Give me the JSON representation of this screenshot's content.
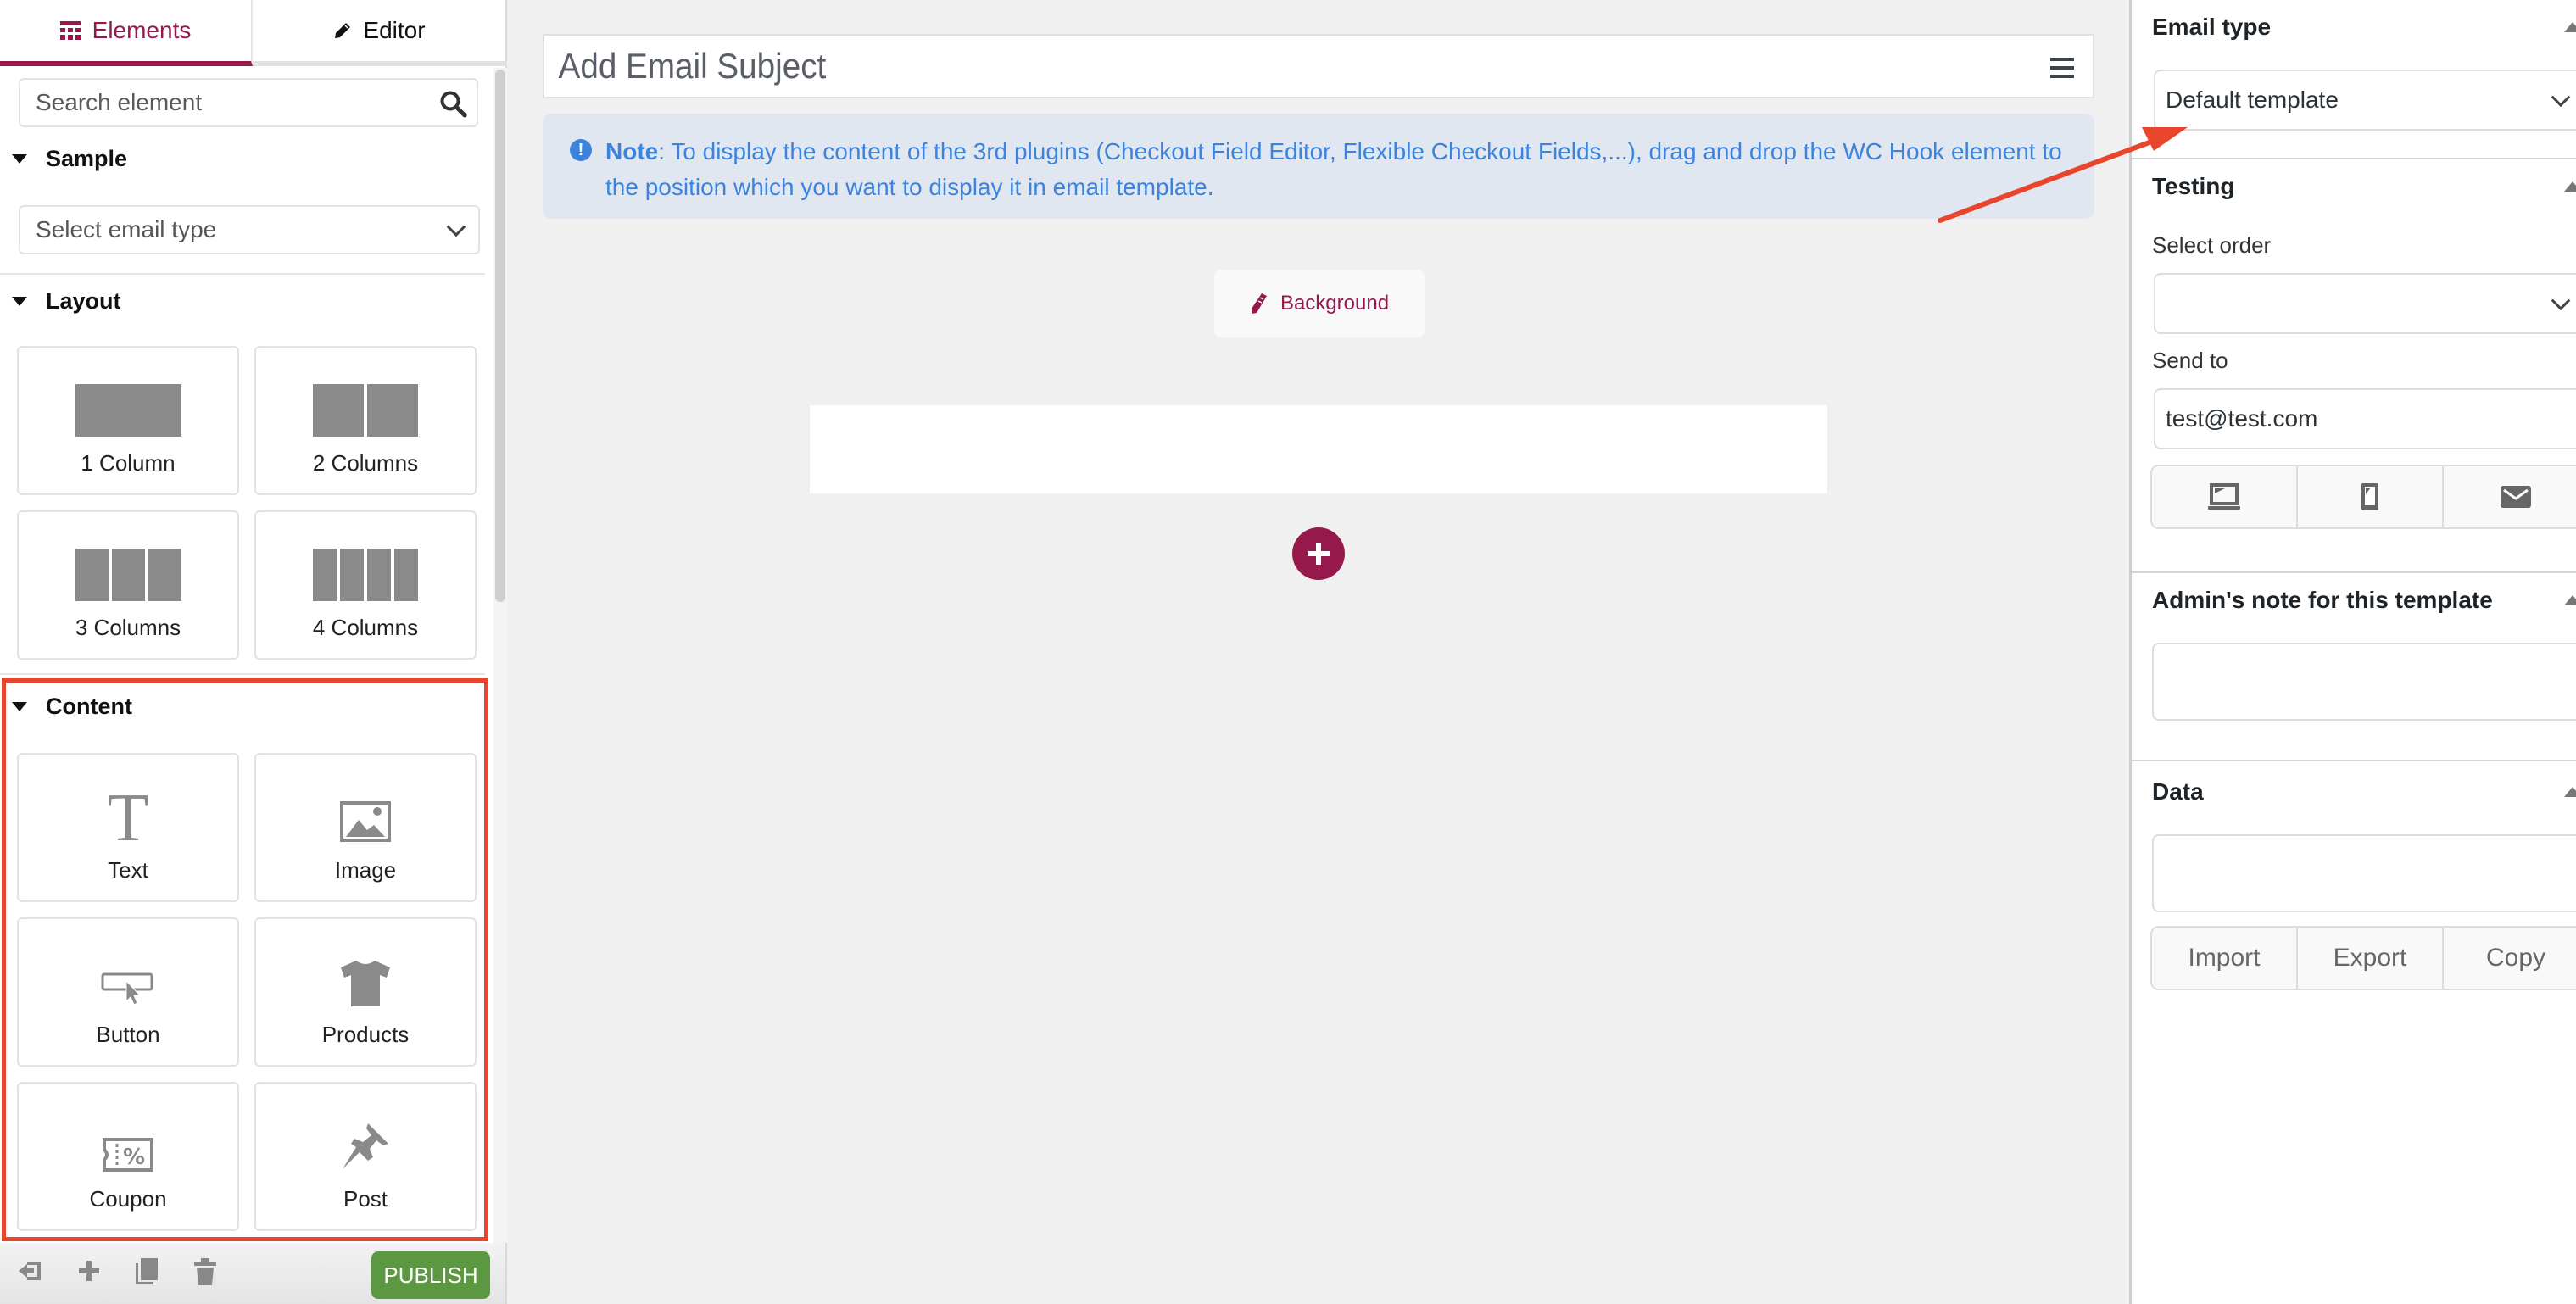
{
  "sidebar": {
    "tabs": [
      {
        "label": "Elements",
        "icon": "grid-icon",
        "active": true
      },
      {
        "label": "Editor",
        "icon": "pencil-icon",
        "active": false
      }
    ],
    "search": {
      "placeholder": "Search element",
      "value": ""
    },
    "sample": {
      "title": "Sample",
      "select_value": "Select email type"
    },
    "layout": {
      "title": "Layout",
      "items": [
        {
          "label": "1 Column",
          "columns": 1
        },
        {
          "label": "2 Columns",
          "columns": 2
        },
        {
          "label": "3 Columns",
          "columns": 3
        },
        {
          "label": "4 Columns",
          "columns": 4
        }
      ]
    },
    "content": {
      "title": "Content",
      "items": [
        {
          "label": "Text",
          "icon": "text-icon"
        },
        {
          "label": "Image",
          "icon": "image-icon"
        },
        {
          "label": "Button",
          "icon": "button-cursor-icon"
        },
        {
          "label": "Products",
          "icon": "tshirt-icon"
        },
        {
          "label": "Coupon",
          "icon": "coupon-icon"
        },
        {
          "label": "Post",
          "icon": "pushpin-icon"
        }
      ]
    },
    "footer": {
      "icons": [
        "exit-icon",
        "plus-icon",
        "copy-icon",
        "trash-icon"
      ],
      "publish_label": "PUBLISH"
    }
  },
  "main": {
    "subject_placeholder": "Add Email Subject",
    "note": {
      "label": "Note",
      "text": ": To display the content of the 3rd plugins (Checkout Field Editor, Flexible Checkout Fields,...), drag and drop the WC Hook element to the position which you want to display it in email template."
    },
    "background_button": "Background"
  },
  "right_panel": {
    "email_type": {
      "title": "Email type",
      "value": "Default template"
    },
    "testing": {
      "title": "Testing",
      "select_order_label": "Select order",
      "select_order_value": "",
      "send_to_label": "Send to",
      "send_to_value": "test@test.com",
      "preview_buttons": [
        "laptop-icon",
        "mobile-icon",
        "envelope-icon"
      ]
    },
    "admin_note": {
      "title": "Admin's note for this template",
      "value": ""
    },
    "data": {
      "title": "Data",
      "value": "",
      "buttons": [
        "Import",
        "Export",
        "Copy"
      ]
    }
  },
  "colors": {
    "brand": "#96194b",
    "publish": "#5c9742",
    "note_text": "#3b83dc",
    "note_bg": "#e1e7f1",
    "annotation": "#e8452c"
  }
}
